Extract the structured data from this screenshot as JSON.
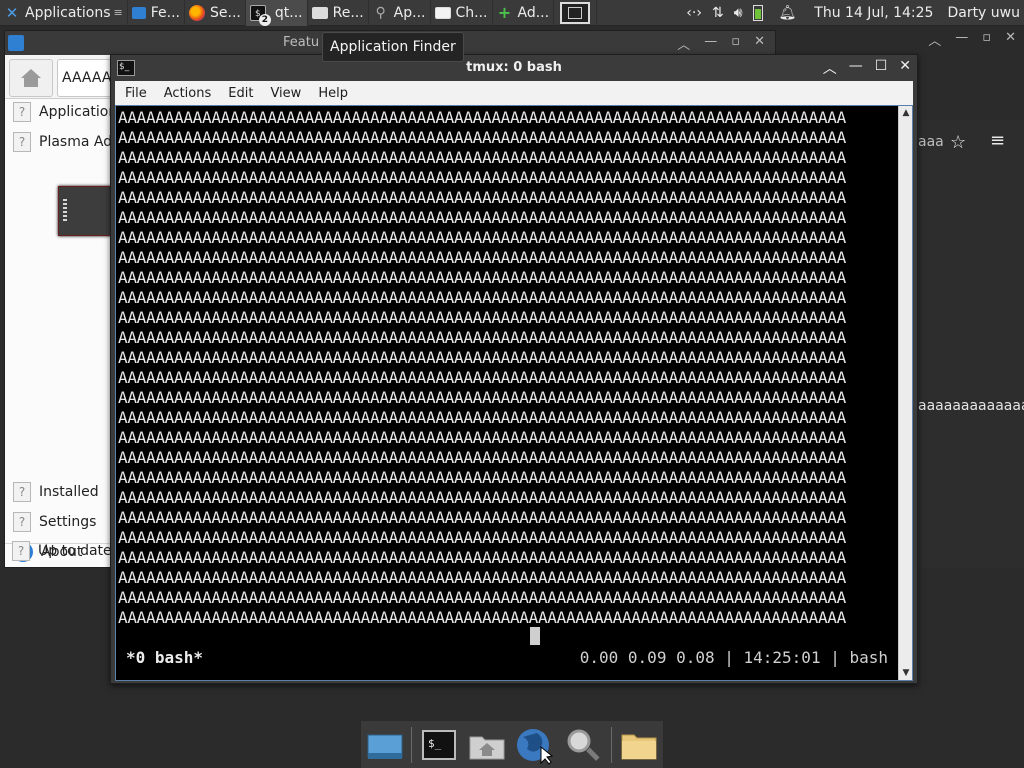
{
  "top_panel": {
    "applications_label": "Applications",
    "tasks": [
      {
        "label": "Fe...",
        "icon": "window-blue-icon"
      },
      {
        "label": "Se...",
        "icon": "firefox-icon"
      },
      {
        "label": "qt...",
        "icon": "terminal-badge-icon",
        "badge": "2"
      },
      {
        "label": "Re...",
        "icon": "folder-icon"
      },
      {
        "label": "Ap...",
        "icon": "search-icon"
      },
      {
        "label": "Ch...",
        "icon": "window-icon"
      },
      {
        "label": "Ad...",
        "icon": "plus-icon"
      }
    ],
    "clock": "Thu 14 Jul, 14:25",
    "user": "Darty uwu"
  },
  "tooltip": "Application Finder",
  "software_window": {
    "title": "Featu",
    "search_value": "AAAAAA",
    "sidebar_top": [
      "Application",
      "Plasma Add"
    ],
    "sidebar_bottom": [
      {
        "label": "Installed",
        "icon": "question-icon"
      },
      {
        "label": "Settings",
        "icon": "question-icon"
      },
      {
        "label": "About",
        "icon": "about-icon"
      },
      {
        "label": "Up to date",
        "icon": "question-icon"
      }
    ],
    "right_text": "aaa",
    "long_text": "aaaaaaaaaaaaa"
  },
  "terminal": {
    "title": "tmux: 0 bash",
    "menu": [
      "File",
      "Actions",
      "Edit",
      "View",
      "Help"
    ],
    "line_text": "AAAAAAAAAAAAAAAAAAAAAAAAAAAAAAAAAAAAAAAAAAAAAAAAAAAAAAAAAAAAAAAAAAAAAAAAAAAAAA",
    "line_count": 26,
    "status_left": "*0 bash*",
    "status_right": "0.00 0.09 0.08 | 14:25:01 | bash"
  },
  "dock": {
    "items": [
      "show-desktop-icon",
      "terminal-icon",
      "home-folder-icon",
      "web-browser-icon",
      "app-finder-icon",
      "files-folder-icon"
    ]
  },
  "colors": {
    "panel": "#3a3a3a",
    "terminal_bg": "#000000",
    "accent": "#2d7fd6"
  }
}
